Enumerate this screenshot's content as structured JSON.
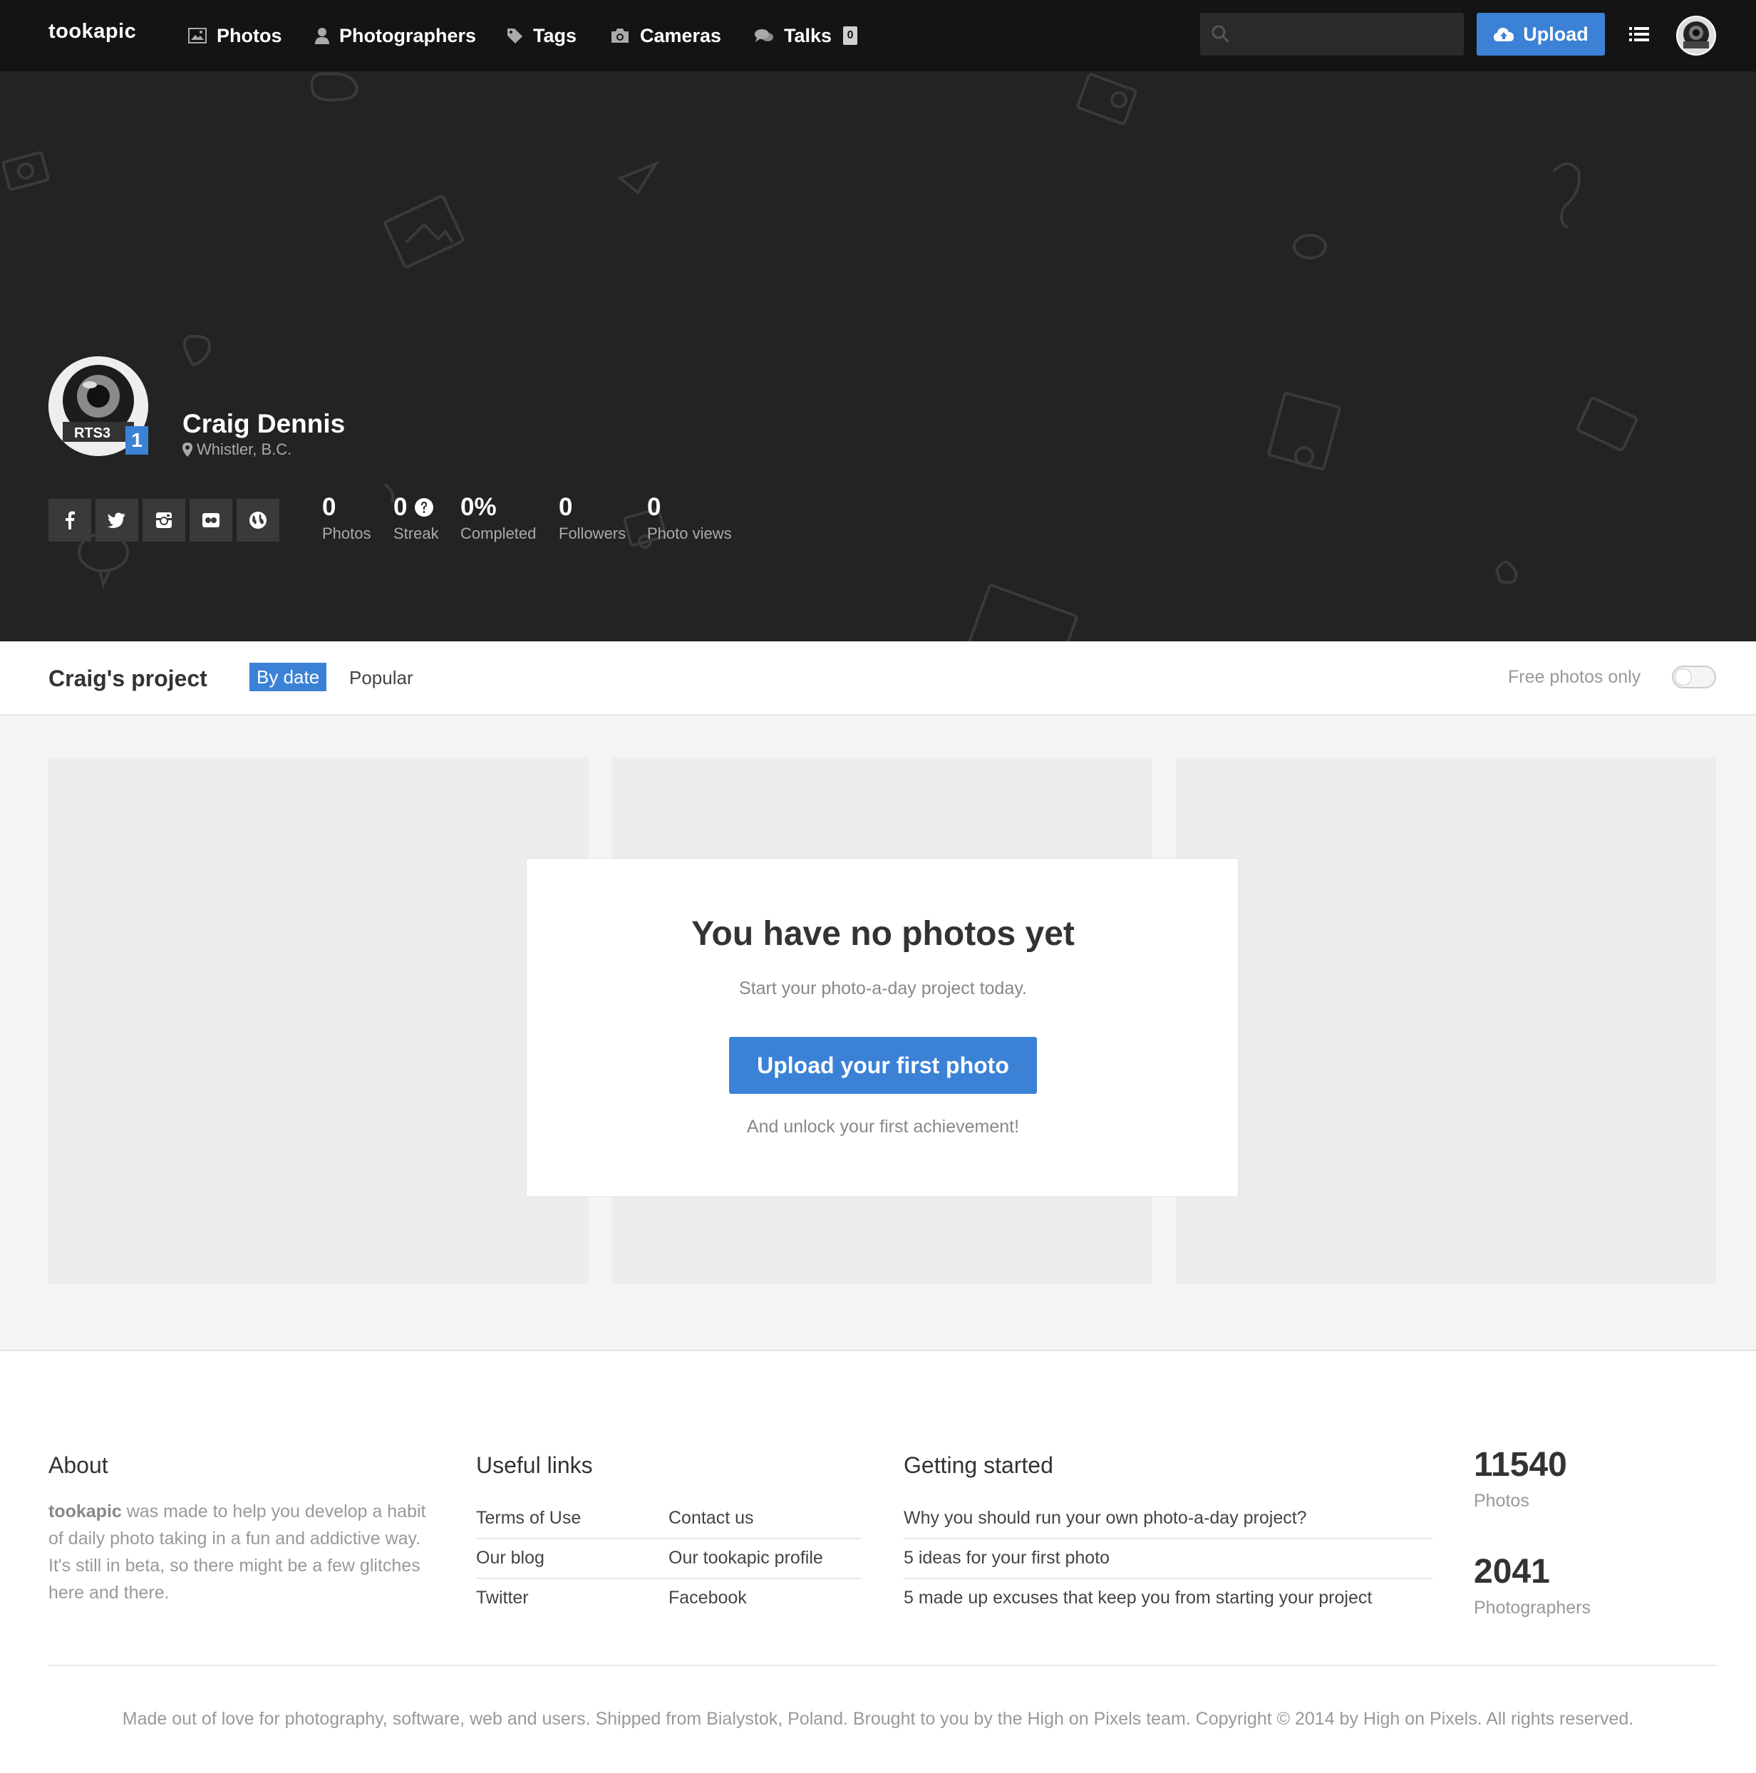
{
  "nav": {
    "logo": "tookapic",
    "items": [
      {
        "label": "Photos",
        "icon": "image-icon"
      },
      {
        "label": "Photographers",
        "icon": "user-icon"
      },
      {
        "label": "Tags",
        "icon": "tag-icon"
      },
      {
        "label": "Cameras",
        "icon": "camera-icon"
      },
      {
        "label": "Talks",
        "icon": "chat-icon"
      }
    ],
    "talks_count": "0",
    "search_placeholder": "",
    "upload_label": "Upload"
  },
  "profile": {
    "name": "Craig Dennis",
    "location": "Whistler, B.C.",
    "level": "1",
    "socials": [
      "facebook-icon",
      "twitter-icon",
      "instagram-icon",
      "flickr-icon",
      "globe-icon"
    ],
    "stats": {
      "photos": {
        "value": "0",
        "label": "Photos"
      },
      "streak": {
        "value": "0",
        "label": "Streak"
      },
      "completed": {
        "value": "0%",
        "label": "Completed"
      },
      "followers": {
        "value": "0",
        "label": "Followers"
      },
      "views": {
        "value": "0",
        "label": "Photo views"
      }
    }
  },
  "project": {
    "title": "Craig's project",
    "tabs": [
      "By date",
      "Popular"
    ],
    "active_tab": "By date",
    "free_photos_label": "Free photos only",
    "free_photos_enabled": false
  },
  "empty_state": {
    "title": "You have no photos yet",
    "subtitle": "Start your photo-a-day project today.",
    "button": "Upload your first photo",
    "note": "And unlock your first achievement!"
  },
  "footer": {
    "about": {
      "heading": "About",
      "brand": "tookapic",
      "text": " was made to help you develop a habit of daily photo taking in a fun and addictive way. It's still in beta, so there might be a few glitches here and there."
    },
    "useful_links": {
      "heading": "Useful links",
      "rows": [
        [
          "Terms of Use",
          "Contact us"
        ],
        [
          "Our blog",
          "Our tookapic profile"
        ],
        [
          "Twitter",
          "Facebook"
        ]
      ]
    },
    "getting_started": {
      "heading": "Getting started",
      "links": [
        "Why you should run your own photo-a-day project?",
        "5 ideas for your first photo",
        "5 made up excuses that keep you from starting your project"
      ]
    },
    "stats": [
      {
        "value": "11540",
        "label": "Photos"
      },
      {
        "value": "2041",
        "label": "Photographers"
      }
    ],
    "copyright": "Made out of love for photography, software, web and users. Shipped from Bialystok, Poland. Brought to you by the High on Pixels team. Copyright © 2014 by High on Pixels. All rights reserved."
  },
  "colors": {
    "accent": "#3b82d6",
    "nav_bg": "#141414",
    "hero_bg": "#232323",
    "grid_bg": "#f4f4f4"
  }
}
